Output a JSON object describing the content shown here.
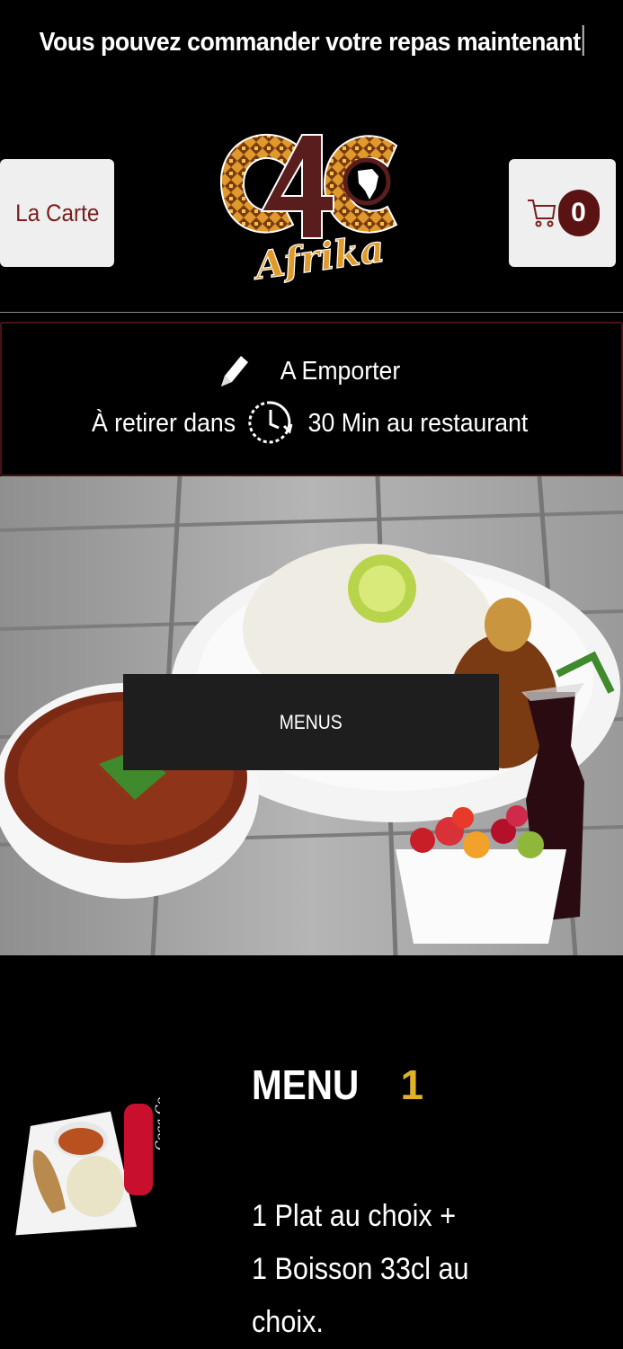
{
  "banner": {
    "text": "Vous pouvez commander votre repas maintenant"
  },
  "header": {
    "carte_label": "La Carte",
    "cart_count": "0",
    "logo_text": "4C",
    "logo_script": "Afrika"
  },
  "order": {
    "mode_label": "A Emporter",
    "pickup_prefix": "À retirer dans",
    "pickup_suffix": "30 Min au restaurant"
  },
  "hero": {
    "button_label": "MENUS"
  },
  "menu": {
    "title": "MENU",
    "number": "1",
    "desc_lines": [
      "1 Plat au choix +",
      "1 Boisson 33cl au",
      "choix."
    ]
  },
  "colors": {
    "background": "#000000",
    "accent": "#e0b12b",
    "brand_dark": "#5a1212",
    "button_light": "#efefef"
  },
  "icons": [
    "pencil-icon",
    "clock-icon",
    "cart-icon"
  ]
}
